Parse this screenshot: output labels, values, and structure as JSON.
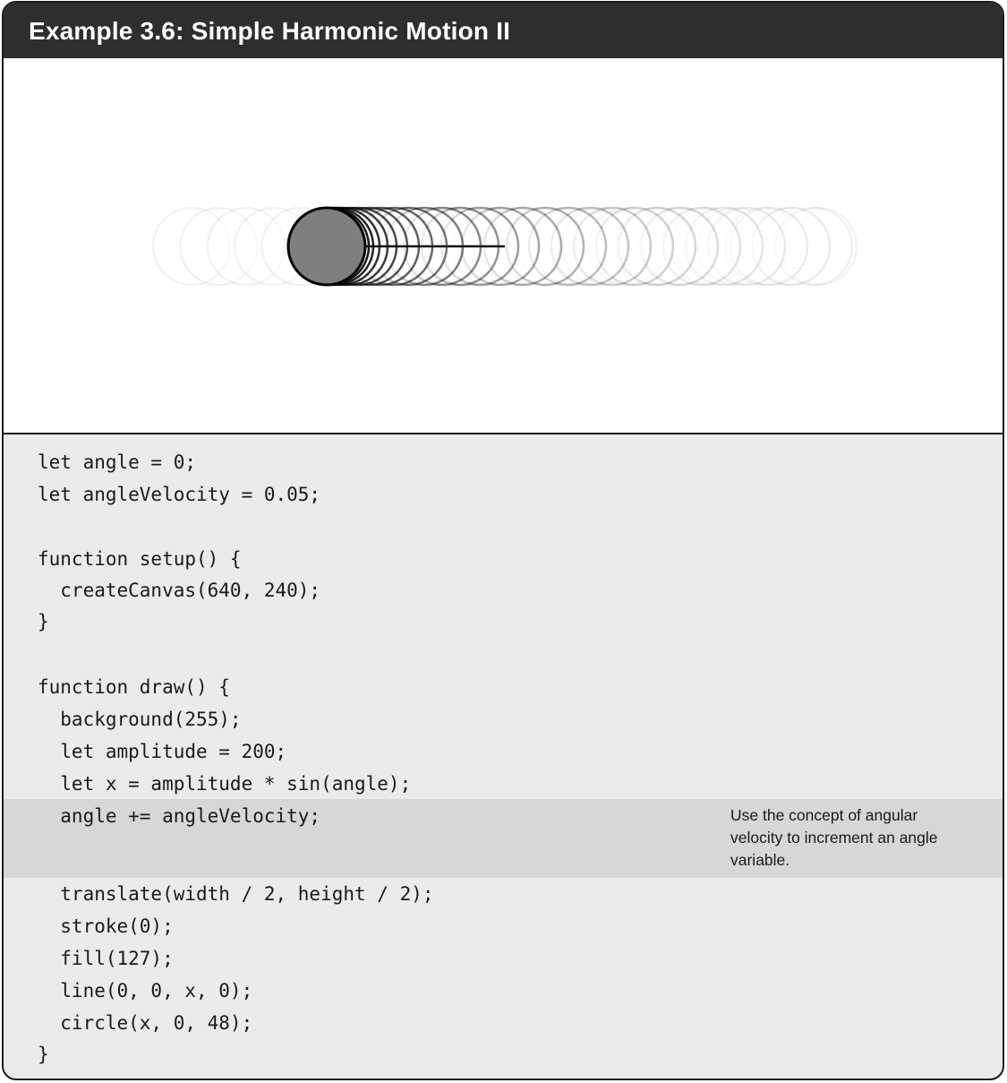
{
  "header": {
    "title": "Example 3.6: Simple Harmonic Motion II"
  },
  "code": {
    "lines": [
      "let angle = 0;",
      "let angleVelocity = 0.05;",
      "",
      "function setup() {",
      "  createCanvas(640, 240);",
      "}",
      "",
      "function draw() {",
      "  background(255);",
      "  let amplitude = 200;",
      "  let x = amplitude * sin(angle);",
      "  angle += angleVelocity;",
      "",
      "  translate(width / 2, height / 2);",
      "  stroke(0);",
      "  fill(127);",
      "  line(0, 0, x, 0);",
      "  circle(x, 0, 48);",
      "}"
    ]
  },
  "annotation": {
    "text": "Use the concept of angular velocity to increment an angle variable."
  },
  "colors": {
    "header_bg": "#2e2e2e",
    "code_bg": "#ebebeb",
    "highlight_bg": "#d7d7d7",
    "circle_fill": "#7f7f7f"
  }
}
